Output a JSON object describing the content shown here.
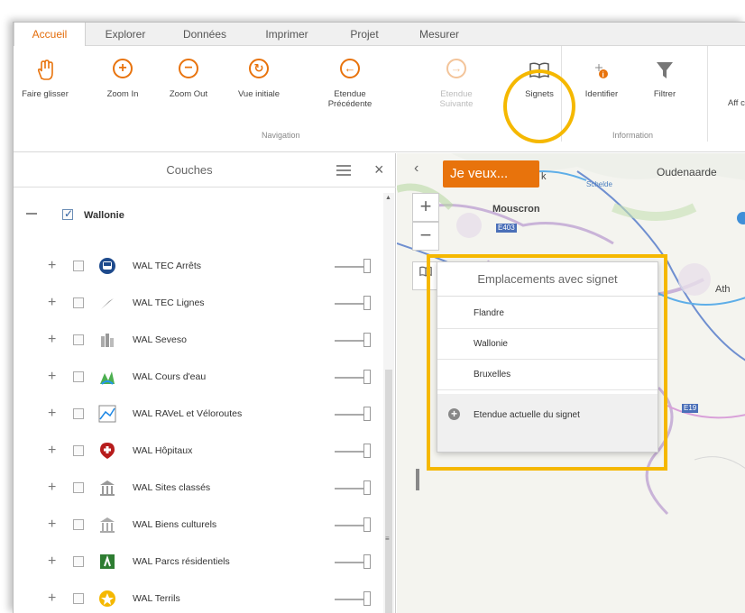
{
  "tabs": [
    "Accueil",
    "Explorer",
    "Données",
    "Imprimer",
    "Projet",
    "Mesurer"
  ],
  "active_tab": "Accueil",
  "ribbon": {
    "buttons": [
      {
        "label": "Faire glisser",
        "icon": "hand-icon"
      },
      {
        "label": "Zoom In",
        "icon": "zoom-in-icon"
      },
      {
        "label": "Zoom Out",
        "icon": "zoom-out-icon"
      },
      {
        "label": "Vue initiale",
        "icon": "initial-view-icon"
      },
      {
        "label": "Etendue Précédente",
        "icon": "previous-extent-icon"
      },
      {
        "label": "Etendue Suivante",
        "icon": "next-extent-icon"
      },
      {
        "label": "Signets",
        "icon": "bookmark-icon"
      },
      {
        "label": "Identifier",
        "icon": "identify-icon"
      },
      {
        "label": "Filtrer",
        "icon": "filter-icon"
      },
      {
        "label": "Aff c",
        "icon": ""
      }
    ],
    "groups": {
      "navigation": "Navigation",
      "information": "Information"
    }
  },
  "panel": {
    "title": "Couches",
    "root": "Wallonie",
    "layers": [
      "WAL TEC Arrêts",
      "WAL TEC Lignes",
      "WAL Seveso",
      "WAL Cours d'eau",
      "WAL RAVeL et Véloroutes",
      "WAL Hôpitaux",
      "WAL Sites classés",
      "WAL Biens culturels",
      "WAL Parcs résidentiels",
      "WAL Terrils"
    ]
  },
  "map": {
    "jeveux": "Je veux...",
    "labels": [
      "Oudenaarde",
      "Mouscron",
      "Ath",
      "k",
      "Schelde"
    ],
    "roads": [
      "E403",
      "E19"
    ]
  },
  "bookmarks": {
    "title": "Emplacements avec signet",
    "items": [
      "Flandre",
      "Wallonie",
      "Bruxelles"
    ],
    "add_label": "Etendue actuelle du signet"
  },
  "colors": {
    "accent": "#e8730c",
    "highlight": "#f5b800",
    "road": "#4a6fb8"
  }
}
